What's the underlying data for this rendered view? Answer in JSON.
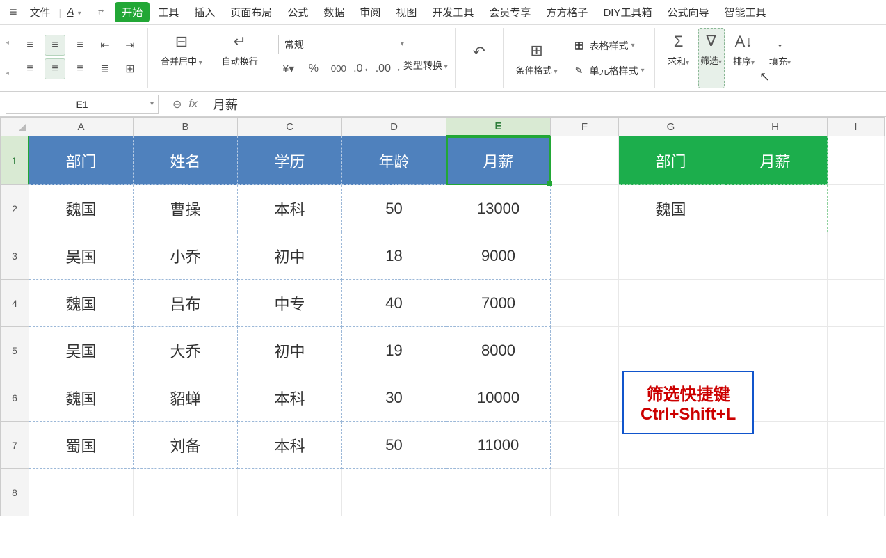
{
  "menu": {
    "file": "文件",
    "fmt": "A"
  },
  "tabs": [
    "开始",
    "工具",
    "插入",
    "页面布局",
    "公式",
    "数据",
    "审阅",
    "视图",
    "开发工具",
    "会员专享",
    "方方格子",
    "DIY工具箱",
    "公式向导",
    "智能工具"
  ],
  "active_tab": 0,
  "ribbon": {
    "merge": "合并居中",
    "wrap": "自动换行",
    "numfmt": "常规",
    "typeconv": "类型转换",
    "condfmt": "条件格式",
    "tblstyle": "表格样式",
    "cellstyle": "单元格样式",
    "sum": "求和",
    "filter": "筛选",
    "sort": "排序",
    "fill": "填充"
  },
  "namebox": "E1",
  "formula": "月薪",
  "cols": [
    "A",
    "B",
    "C",
    "D",
    "E",
    "F",
    "G",
    "H",
    "I"
  ],
  "rows": [
    "1",
    "2",
    "3",
    "4",
    "5",
    "6",
    "7",
    "8"
  ],
  "table1": {
    "headers": [
      "部门",
      "姓名",
      "学历",
      "年龄",
      "月薪"
    ],
    "rows": [
      [
        "魏国",
        "曹操",
        "本科",
        "50",
        "13000"
      ],
      [
        "吴国",
        "小乔",
        "初中",
        "18",
        "9000"
      ],
      [
        "魏国",
        "吕布",
        "中专",
        "40",
        "7000"
      ],
      [
        "吴国",
        "大乔",
        "初中",
        "19",
        "8000"
      ],
      [
        "魏国",
        "貂蝉",
        "本科",
        "30",
        "10000"
      ],
      [
        "蜀国",
        "刘备",
        "本科",
        "50",
        "11000"
      ]
    ]
  },
  "table2": {
    "headers": [
      "部门",
      "月薪"
    ],
    "rows": [
      [
        "魏国",
        ""
      ]
    ]
  },
  "annotation": {
    "line1": "筛选快捷键",
    "line2": "Ctrl+Shift+L"
  }
}
